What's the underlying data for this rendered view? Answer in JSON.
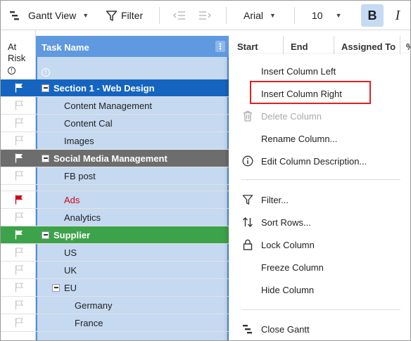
{
  "toolbar": {
    "view_label": "Gantt View",
    "filter_label": "Filter",
    "font_family": "Arial",
    "font_size": "10",
    "bold_label": "B",
    "italic_label": "I"
  },
  "columns": {
    "at_risk_line1": "At",
    "at_risk_line2": "Risk",
    "task_name": "Task Name",
    "start": "Start",
    "end": "End",
    "assigned_to": "Assigned To",
    "extra": "%"
  },
  "rows": [
    {
      "label": "Section 1 - Web Design",
      "kind": "section",
      "color": "#1565c0",
      "flag": "white",
      "collapse": true
    },
    {
      "label": "Content Management",
      "kind": "child",
      "flag": "outline"
    },
    {
      "label": "Content Cal",
      "kind": "child",
      "flag": "outline"
    },
    {
      "label": "Images",
      "kind": "child",
      "flag": "outline"
    },
    {
      "label": "Social Media Management",
      "kind": "section",
      "color": "#6d6d6d",
      "flag": "white",
      "collapse": true
    },
    {
      "label": "FB post",
      "kind": "child",
      "flag": "outline"
    },
    {
      "label": "",
      "kind": "child",
      "flag": "outline"
    },
    {
      "label": "Ads",
      "kind": "child-red",
      "flag": "red"
    },
    {
      "label": "Analytics",
      "kind": "child",
      "flag": "outline"
    },
    {
      "label": "Supplier",
      "kind": "section",
      "color": "#3da34a",
      "flag": "white",
      "collapse": true
    },
    {
      "label": "US",
      "kind": "child",
      "flag": "outline"
    },
    {
      "label": "UK",
      "kind": "child",
      "flag": "outline"
    },
    {
      "label": "EU",
      "kind": "child",
      "flag": "outline",
      "collapse": true
    },
    {
      "label": "Germany",
      "kind": "grandchild",
      "flag": "outline"
    },
    {
      "label": "France",
      "kind": "grandchild",
      "flag": "outline"
    },
    {
      "label": "",
      "kind": "child",
      "flag": "outline"
    }
  ],
  "context_menu": {
    "insert_left": "Insert Column Left",
    "insert_right": "Insert Column Right",
    "delete": "Delete Column",
    "rename": "Rename Column...",
    "edit_desc": "Edit Column Description...",
    "filter": "Filter...",
    "sort": "Sort Rows...",
    "lock": "Lock Column",
    "freeze": "Freeze Column",
    "hide": "Hide Column",
    "close_gantt": "Close Gantt"
  },
  "colors": {
    "accent": "#5f9ae0",
    "highlight": "#e02020",
    "flag_red": "#d0021b"
  }
}
